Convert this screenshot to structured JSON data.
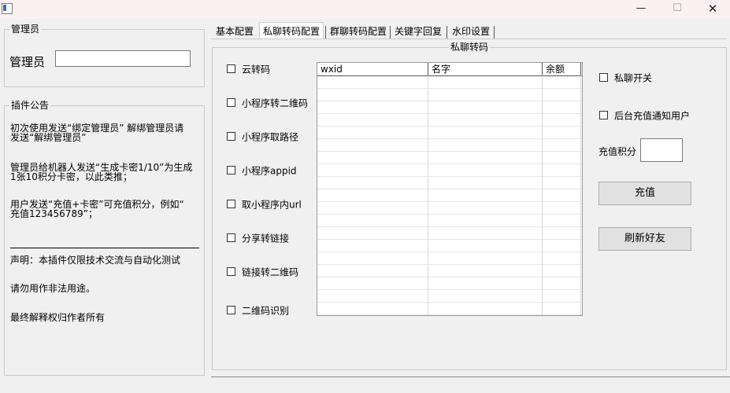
{
  "window": {
    "controls": {
      "minimize": "—",
      "maximize": "☐",
      "close": "✕"
    }
  },
  "admin_group": {
    "title": "管理员",
    "label": "管理员",
    "input_value": ""
  },
  "plugin_notice": {
    "title": "插件公告",
    "lines": [
      "初次使用发送“绑定管理员”   解绑管理员请",
      "发送“解绑管理员”",
      "管理员给机器人发送“生成卡密1/10”为生成",
      "1张10积分卡密，以此类推；",
      "用户发送“充值+卡密”可充值积分，例如“",
      "充值123456789”；",
      "声明：本插件仅限技术交流与自动化测试",
      "请勿用作非法用途。",
      "最终解释权归作者所有"
    ]
  },
  "tabs": [
    {
      "label": "基本配置",
      "active": false
    },
    {
      "label": "私聊转码配置",
      "active": true
    },
    {
      "label": "群聊转码配置",
      "active": false
    },
    {
      "label": "关键字回复",
      "active": false
    },
    {
      "label": "水印设置",
      "active": false
    }
  ],
  "private_transcode": {
    "title": "私聊转码",
    "checkboxes": [
      {
        "label": "云转码",
        "checked": false
      },
      {
        "label": "小程序转二维码",
        "checked": false
      },
      {
        "label": "小程序取路径",
        "checked": false
      },
      {
        "label": "小程序appid",
        "checked": false
      },
      {
        "label": "取小程序内url",
        "checked": false
      },
      {
        "label": "分享转链接",
        "checked": false
      },
      {
        "label": "链接转二维码",
        "checked": false
      },
      {
        "label": "二维码识别",
        "checked": false
      }
    ],
    "table": {
      "columns": [
        "wxid",
        "名字",
        "余额"
      ],
      "rows": []
    },
    "private_switch": {
      "label": "私聊开关",
      "checked": false
    },
    "notify_user": {
      "label": "后台充值通知用户",
      "checked": false
    },
    "recharge_points_label": "充值积分",
    "recharge_points_value": "",
    "recharge_button": "充值",
    "refresh_button": "刷新好友"
  }
}
